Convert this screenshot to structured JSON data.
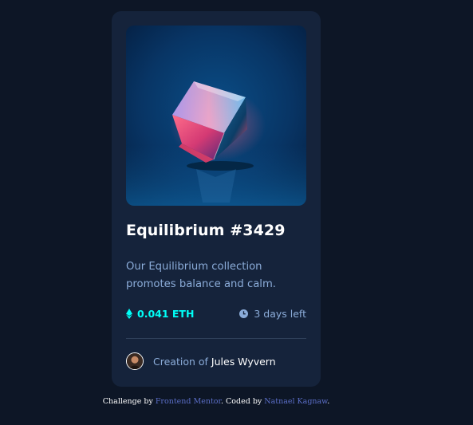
{
  "card": {
    "title": "Equilibrium #3429",
    "description": "Our Equilibrium collection promotes balance and calm.",
    "price": "0.041 ETH",
    "time_left": "3 days left",
    "creator_prefix": "Creation of",
    "creator_name": "Jules Wyvern"
  },
  "icons": {
    "price": "ethereum-icon",
    "time": "clock-icon"
  },
  "colors": {
    "background": "#0d1626",
    "card": "#15233b",
    "accent": "#00fff7",
    "muted_text": "#8bacd9",
    "link": "#5b6ec8"
  },
  "attribution": {
    "prefix": "Challenge by",
    "challenge_link": "Frontend Mentor",
    "middle": ". Coded by",
    "author_link": "Natnael Kagnaw",
    "suffix": "."
  }
}
